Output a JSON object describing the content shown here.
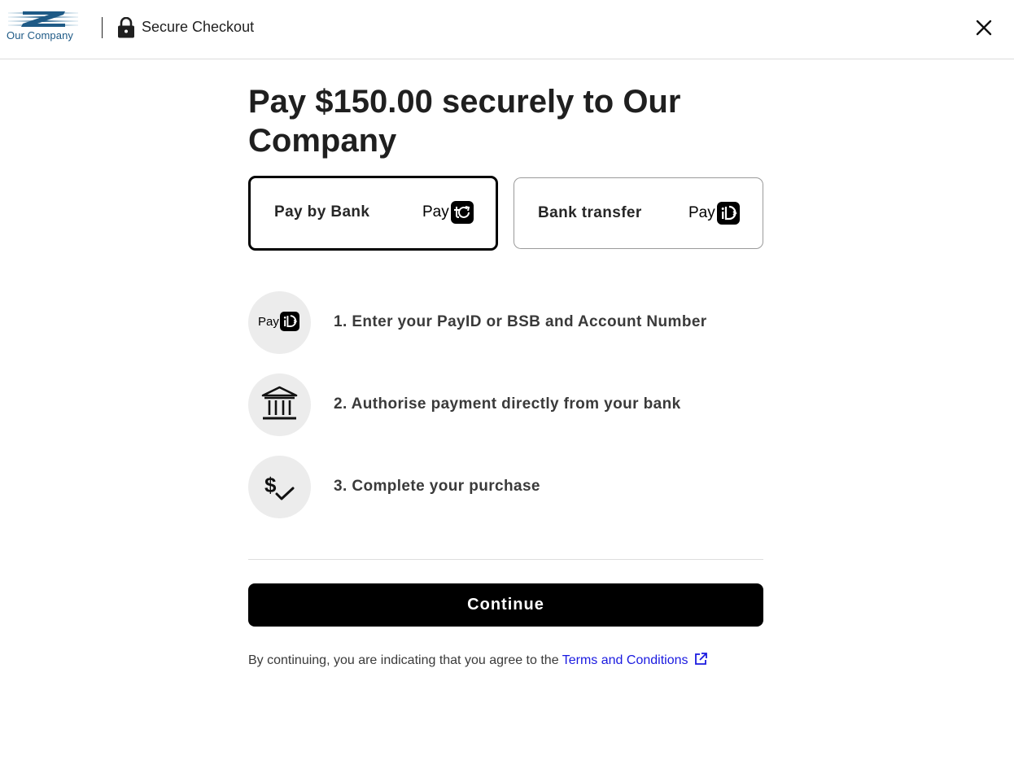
{
  "header": {
    "logo_text": "Our Company",
    "title": "Secure Checkout",
    "icons": {
      "lock": "lock-icon",
      "close": "close-icon"
    }
  },
  "main": {
    "title": "Pay $150.00 securely to Our Company",
    "methods": [
      {
        "label": "Pay by Bank",
        "logo_word": "Pay",
        "logo_icon": "payto-logo",
        "selected": true
      },
      {
        "label": "Bank transfer",
        "logo_word": "Pay",
        "logo_icon": "payid-logo",
        "selected": false
      }
    ],
    "steps": [
      {
        "text": "1. Enter your PayID or BSB and Account Number",
        "icon": "payid-logo",
        "icon_word": "Pay"
      },
      {
        "text": "2. Authorise payment directly from your bank",
        "icon": "bank-icon"
      },
      {
        "text": "3. Complete your purchase",
        "icon": "dollar-check-icon"
      }
    ],
    "continue_label": "Continue",
    "terms_prefix": "By continuing, you are indicating that you agree to the ",
    "terms_link": "Terms and Conditions"
  },
  "colors": {
    "brand": "#1e5a86",
    "link": "#1a1ae0",
    "primary_button": "#000000",
    "step_circle_bg": "#ececec"
  }
}
